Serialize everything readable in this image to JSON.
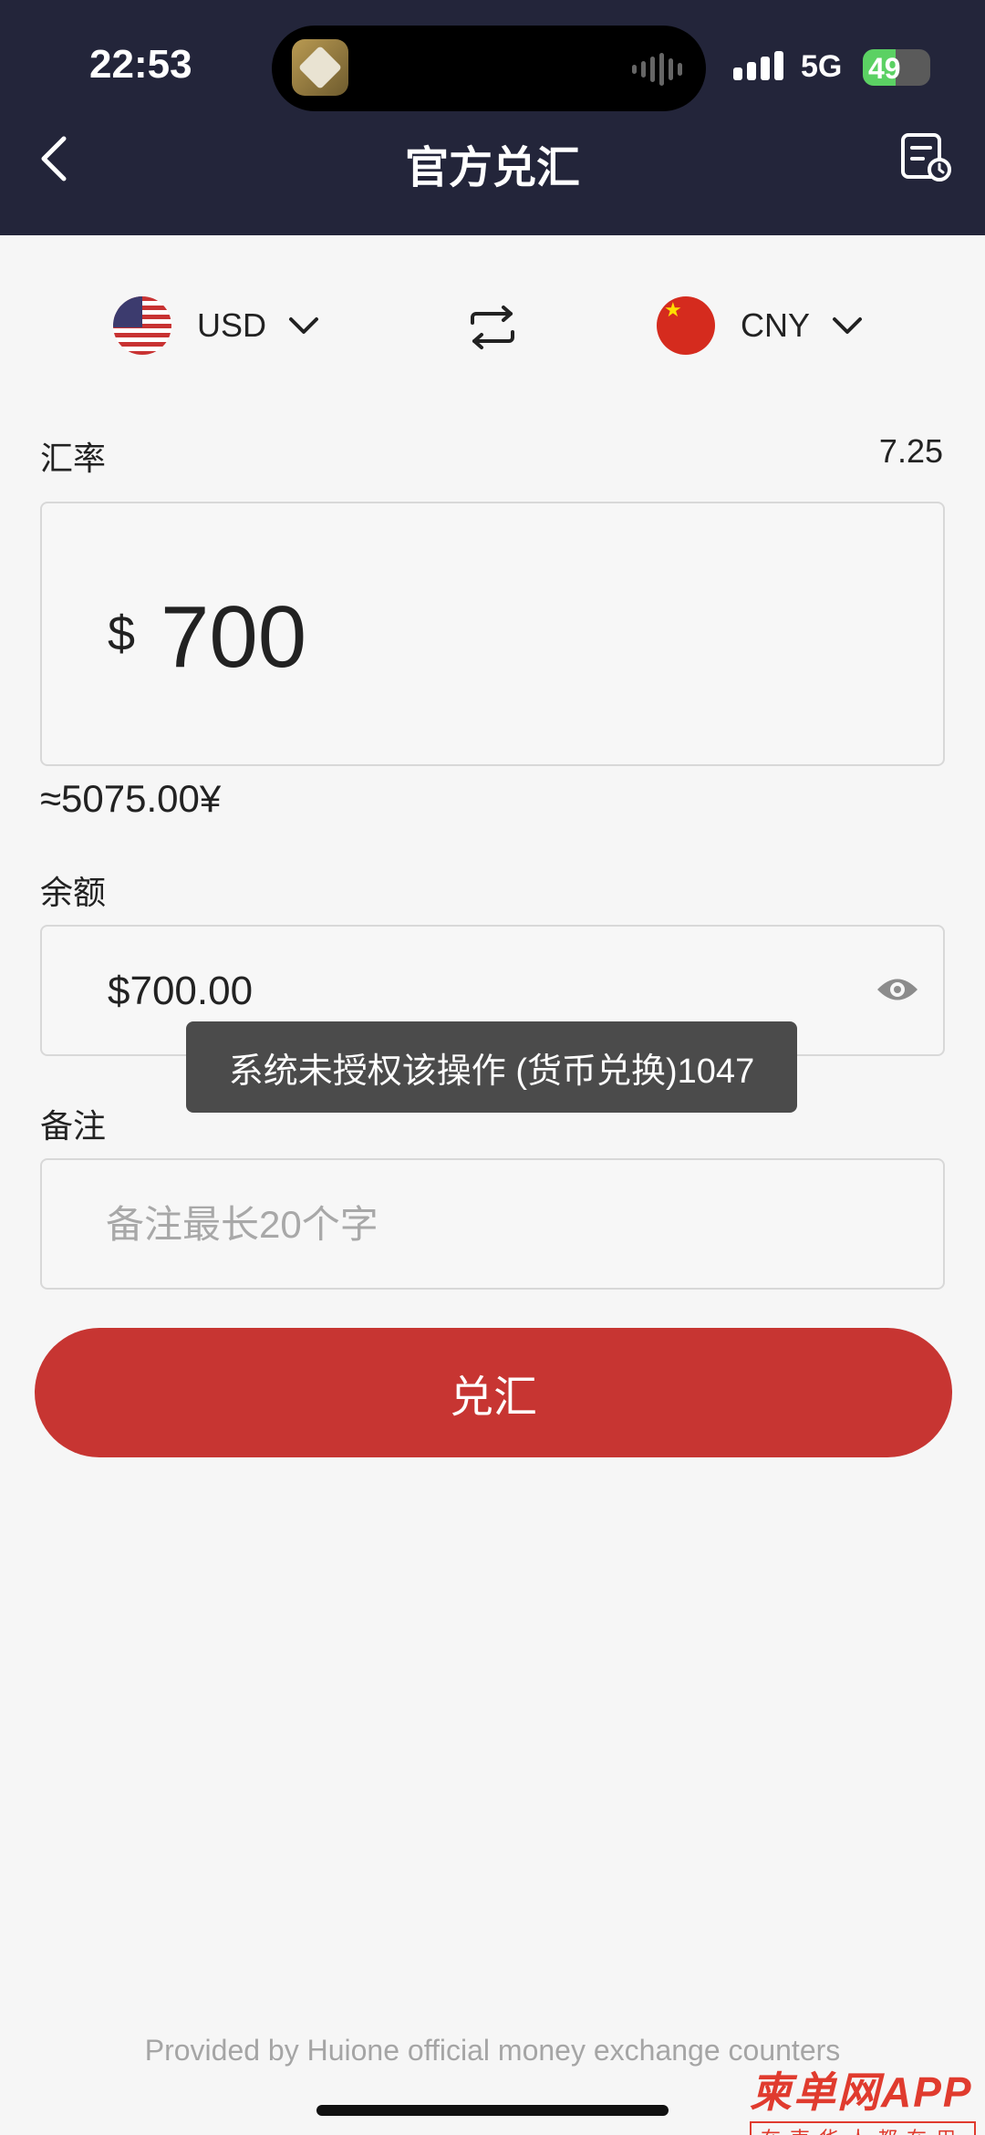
{
  "status_bar": {
    "time": "22:53",
    "network": "5G",
    "battery": "49"
  },
  "header": {
    "title": "官方兑汇"
  },
  "currency": {
    "from": {
      "code": "USD"
    },
    "to": {
      "code": "CNY"
    }
  },
  "rate": {
    "label": "汇率",
    "value": "7.25"
  },
  "amount": {
    "symbol": "$",
    "value": "700",
    "approx": "≈5075.00¥"
  },
  "balance": {
    "label": "余额",
    "value": "$700.00"
  },
  "note": {
    "label": "备注",
    "placeholder": "备注最长20个字"
  },
  "toast": {
    "message": "系统未授权该操作 (货币兑换)1047"
  },
  "exchange_button": {
    "label": "兑汇"
  },
  "footer": {
    "text": "Provided by Huione official money exchange counters"
  },
  "watermark": {
    "main": "柬单网APP",
    "sub": "在柬华人都在用"
  },
  "colors": {
    "header_bg": "#23253a",
    "primary": "#c73532",
    "toast_bg": "#4b4b4b"
  },
  "icons": [
    "back-icon",
    "record-icon",
    "swap-icon",
    "chevron-down-icon",
    "eye-icon",
    "us-flag-icon",
    "cn-flag-icon"
  ]
}
